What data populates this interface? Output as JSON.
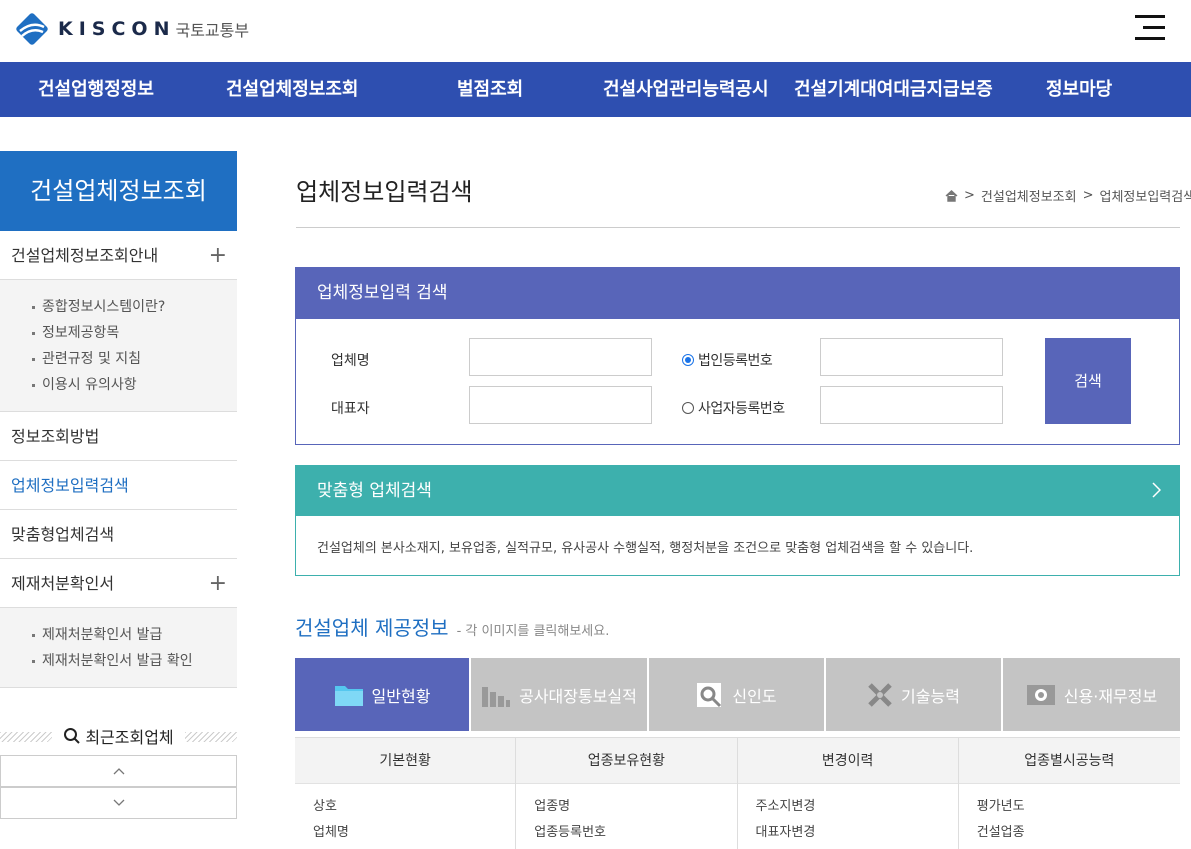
{
  "header": {
    "logo_text": "KISCON",
    "logo_sub": "국토교통부"
  },
  "topnav": {
    "items": [
      "건설업행정정보",
      "건설업체정보조회",
      "벌점조회",
      "건설사업관리능력공시",
      "건설기계대여대금지급보증",
      "정보마당"
    ]
  },
  "sidebar": {
    "title": "건설업체정보조회",
    "sections": [
      {
        "label": "건설업체정보조회안내",
        "expand": "+",
        "subitems": [
          "종합정보시스템이란?",
          "정보제공항목",
          "관련규정 및 지침",
          "이용시 유의사항"
        ]
      },
      {
        "label": "정보조회방법"
      },
      {
        "label": "업체정보입력검색"
      },
      {
        "label": "맞춤형업체검색"
      },
      {
        "label": "제재처분확인서",
        "expand": "+",
        "subitems": [
          "제재처분확인서 발급",
          "제재처분확인서 발급 확인"
        ]
      }
    ],
    "recent_title": "최근조회업체"
  },
  "main": {
    "title": "업체정보입력검색",
    "breadcrumb": [
      "건설업체정보조회",
      "업체정보입력검색"
    ]
  },
  "search": {
    "heading": "업체정보입력 검색",
    "company_label": "업체명",
    "company_value": "",
    "ceo_label": "대표자",
    "ceo_value": "",
    "radio_corp": "법인등록번호",
    "radio_biz": "사업자등록번호",
    "corp_value": "",
    "biz_value": "",
    "button": "검색"
  },
  "custom": {
    "heading": "맞춤형 업체검색",
    "description": "건설업체의 본사소재지, 보유업종, 실적규모, 유사공사 수행실적, 행정처분을 조건으로 맞춤형 업체검색을 할 수 있습니다."
  },
  "provide": {
    "title": "건설업체 제공정보",
    "hint": "- 각 이미지를 클릭해보세요.",
    "tabs": [
      {
        "label": "일반현황",
        "icon": "folder-icon"
      },
      {
        "label": "공사대장통보실적",
        "icon": "bar-chart-icon"
      },
      {
        "label": "신인도",
        "icon": "magnifier-icon"
      },
      {
        "label": "기술능력",
        "icon": "tools-icon"
      },
      {
        "label": "신용·재무정보",
        "icon": "safe-icon"
      }
    ],
    "columns": [
      {
        "head": "기본현황",
        "items": [
          "상호",
          "업체명"
        ]
      },
      {
        "head": "업종보유현황",
        "items": [
          "업종명",
          "업종등록번호"
        ]
      },
      {
        "head": "변경이력",
        "items": [
          "주소지변경",
          "대표자변경"
        ]
      },
      {
        "head": "업종별시공능력",
        "items": [
          "평가년도",
          "건설업종"
        ]
      }
    ]
  },
  "colors": {
    "nav": "#2e4fb0",
    "sidebar_head": "#1f6fc2",
    "search_theme": "#5865b9",
    "custom_theme": "#3db0ad"
  }
}
